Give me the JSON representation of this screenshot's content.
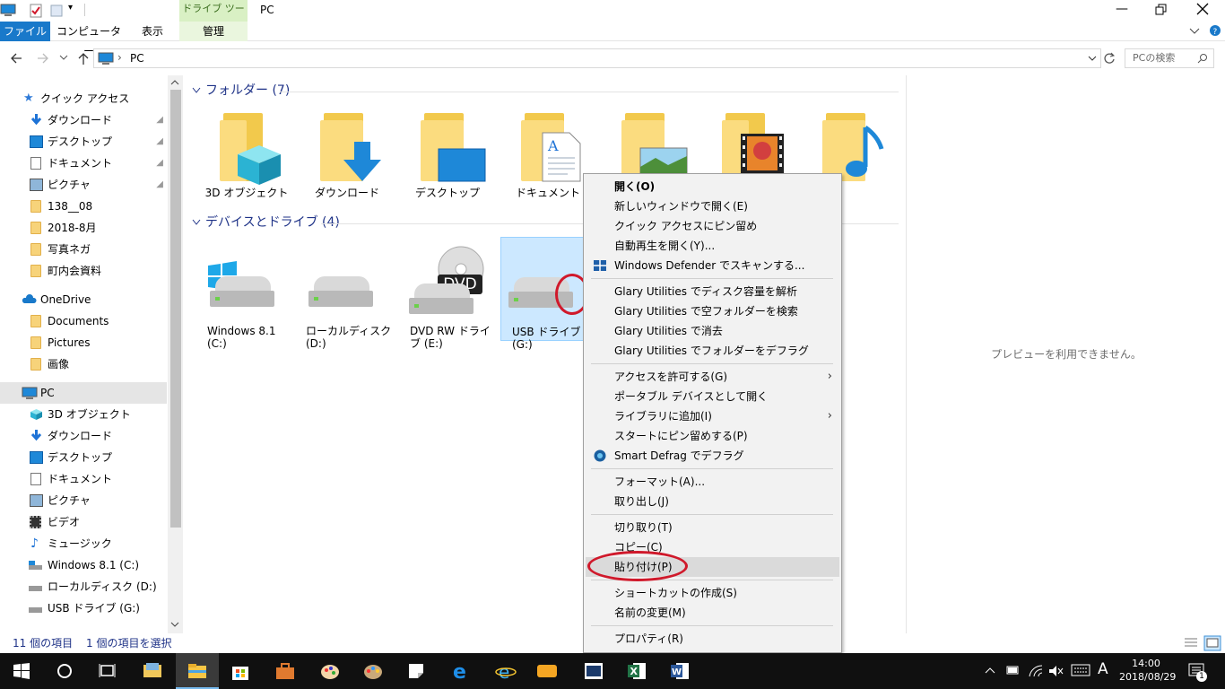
{
  "window": {
    "title": "PC",
    "contextual_tab_header": "ドライブ ツール",
    "qat_dropdown": "▾"
  },
  "ribbon": {
    "tabs": [
      "ファイル",
      "コンピューター",
      "表示",
      "管理"
    ]
  },
  "address": {
    "path": "PC",
    "separator": "›",
    "search_placeholder": "PCの検索"
  },
  "nav": {
    "items": [
      {
        "label": "クイック アクセス",
        "icon": "star-icon",
        "pinned": false
      },
      {
        "label": "ダウンロード",
        "icon": "download-arrow-icon",
        "pinned": true
      },
      {
        "label": "デスクトップ",
        "icon": "desktop-icon",
        "pinned": true
      },
      {
        "label": "ドキュメント",
        "icon": "document-icon",
        "pinned": true
      },
      {
        "label": "ピクチャ",
        "icon": "pictures-icon",
        "pinned": true
      },
      {
        "label": "138__08",
        "icon": "folder-icon",
        "pinned": false
      },
      {
        "label": "2018-8月",
        "icon": "folder-icon",
        "pinned": false
      },
      {
        "label": "写真ネガ",
        "icon": "folder-icon",
        "pinned": false
      },
      {
        "label": "町内会資料",
        "icon": "folder-icon",
        "pinned": false
      },
      {
        "label": "OneDrive",
        "icon": "cloud-icon",
        "pinned": false
      },
      {
        "label": "Documents",
        "icon": "folder-icon",
        "pinned": false
      },
      {
        "label": "Pictures",
        "icon": "folder-icon",
        "pinned": false
      },
      {
        "label": "画像",
        "icon": "folder-icon",
        "pinned": false
      },
      {
        "label": "PC",
        "icon": "computer-icon",
        "pinned": false
      },
      {
        "label": "3D オブジェクト",
        "icon": "cube-icon",
        "pinned": false
      },
      {
        "label": "ダウンロード",
        "icon": "download-arrow-icon",
        "pinned": false
      },
      {
        "label": "デスクトップ",
        "icon": "desktop-icon",
        "pinned": false
      },
      {
        "label": "ドキュメント",
        "icon": "document-icon",
        "pinned": false
      },
      {
        "label": "ピクチャ",
        "icon": "pictures-icon",
        "pinned": false
      },
      {
        "label": "ビデオ",
        "icon": "video-icon",
        "pinned": false
      },
      {
        "label": "ミュージック",
        "icon": "music-note-icon",
        "pinned": false
      },
      {
        "label": "Windows 8.1 (C:)",
        "icon": "drive-icon",
        "pinned": false
      },
      {
        "label": "ローカルディスク (D:)",
        "icon": "drive-icon",
        "pinned": false
      },
      {
        "label": "USB ドライブ (G:)",
        "icon": "usb-drive-icon",
        "pinned": false
      }
    ],
    "pin_glyph": "📌"
  },
  "main": {
    "folders_header": "フォルダー (7)",
    "folders": [
      {
        "label": "3D オブジェクト",
        "overlay": "cube"
      },
      {
        "label": "ダウンロード",
        "overlay": "download"
      },
      {
        "label": "デスクトップ",
        "overlay": "desktop"
      },
      {
        "label": "ドキュメント",
        "overlay": "document"
      },
      {
        "label": "",
        "overlay": "picture"
      },
      {
        "label": "",
        "overlay": "video"
      },
      {
        "label": "ージック",
        "overlay": "music"
      }
    ],
    "drives_header": "デバイスとドライブ (4)",
    "drives": [
      {
        "label": "Windows 8.1 (C:)",
        "badge": "windows"
      },
      {
        "label": "ローカルディスク (D:)",
        "badge": ""
      },
      {
        "label": "DVD RW ドライブ (E:)",
        "badge": "DVD"
      },
      {
        "label": "USB ドライブ (G:)",
        "badge": ""
      }
    ]
  },
  "context_menu": {
    "items": [
      {
        "label": "開く(O)",
        "bold": true,
        "icon": ""
      },
      {
        "label": "新しいウィンドウで開く(E)",
        "icon": ""
      },
      {
        "label": "クイック アクセスにピン留め",
        "icon": ""
      },
      {
        "label": "自動再生を開く(Y)...",
        "icon": ""
      },
      {
        "label": "Windows Defender でスキャンする...",
        "icon": "shield-icon"
      },
      {
        "label": "Glary Utilities でディスク容量を解析",
        "icon": ""
      },
      {
        "label": "Glary Utilities で空フォルダーを検索",
        "icon": ""
      },
      {
        "label": "Glary Utilities で消去",
        "icon": ""
      },
      {
        "label": "Glary Utilities でフォルダーをデフラグ",
        "icon": ""
      },
      {
        "label": "アクセスを許可する(G)",
        "submenu": true,
        "icon": ""
      },
      {
        "label": "ポータブル デバイスとして開く",
        "icon": ""
      },
      {
        "label": "ライブラリに追加(I)",
        "submenu": true,
        "icon": ""
      },
      {
        "label": "スタートにピン留めする(P)",
        "icon": ""
      },
      {
        "label": "Smart Defrag でデフラグ",
        "icon": "smart-defrag-icon"
      },
      {
        "label": "フォーマット(A)...",
        "icon": ""
      },
      {
        "label": "取り出し(J)",
        "icon": ""
      },
      {
        "label": "切り取り(T)",
        "icon": ""
      },
      {
        "label": "コピー(C)",
        "icon": ""
      },
      {
        "label": "貼り付け(P)",
        "highlighted": true,
        "icon": ""
      },
      {
        "label": "ショートカットの作成(S)",
        "icon": ""
      },
      {
        "label": "名前の変更(M)",
        "icon": ""
      },
      {
        "label": "プロパティ(R)",
        "icon": ""
      }
    ],
    "submenu_arrow": "›"
  },
  "preview": {
    "message": "プレビューを利用できません。"
  },
  "status": {
    "item_count": "11 個の項目",
    "selected": "1 個の項目を選択"
  },
  "taskbar": {
    "time": "14:00",
    "date": "2018/08/29",
    "ime": "A",
    "notification_count": "1"
  },
  "annotations": {
    "color": "#d0192b"
  }
}
